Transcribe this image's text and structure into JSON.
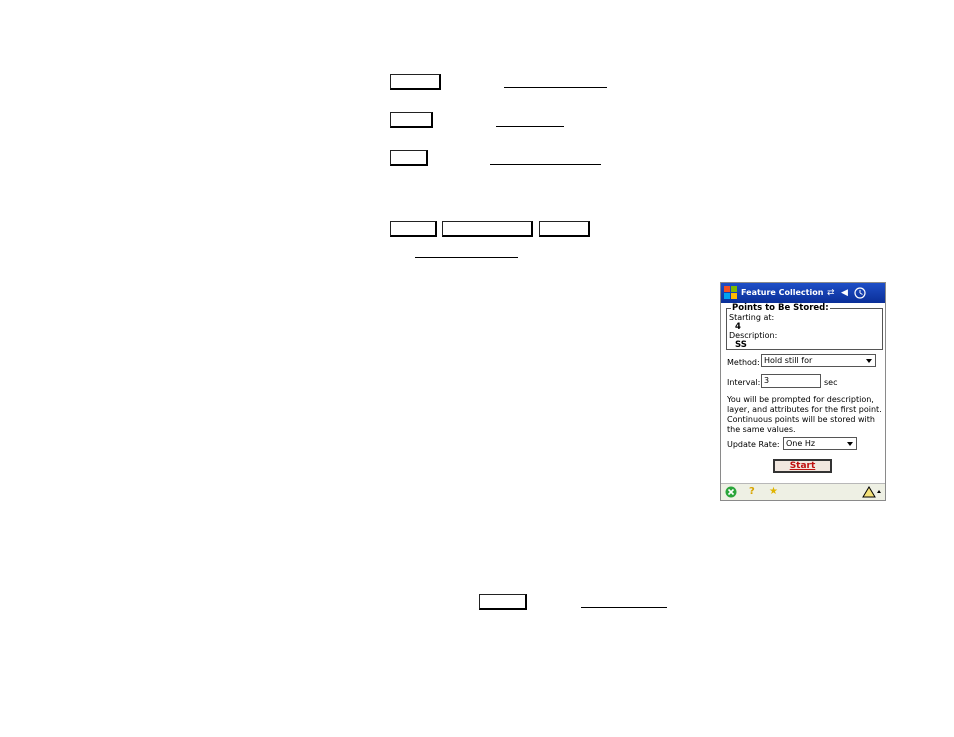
{
  "doc_lines": [],
  "pda": {
    "title": "Feature Collection",
    "title_icons": [
      "sync-arrows-icon",
      "speaker-icon",
      "clock-icon"
    ],
    "group": {
      "title": "Points to Be Stored:",
      "starting_at_label": "Starting at:",
      "starting_at_value": "4",
      "description_label": "Description:",
      "description_value": "SS"
    },
    "method_label": "Method:",
    "method_value": "Hold still for",
    "interval_label": "Interval:",
    "interval_value": "3",
    "interval_unit": "sec",
    "info_text": "You will be prompted for description, layer,  and attributes for the first point. Continuous points will be stored with the same values.",
    "update_rate_label": "Update Rate:",
    "update_rate_value": "One Hz",
    "start_label": "Start",
    "bottom_icons": [
      "close-icon",
      "help-icon",
      "favorites-icon",
      "sip-keyboard-icon"
    ],
    "colors": {
      "titlebar": "#0a2f98",
      "start_text": "#c01010"
    }
  }
}
